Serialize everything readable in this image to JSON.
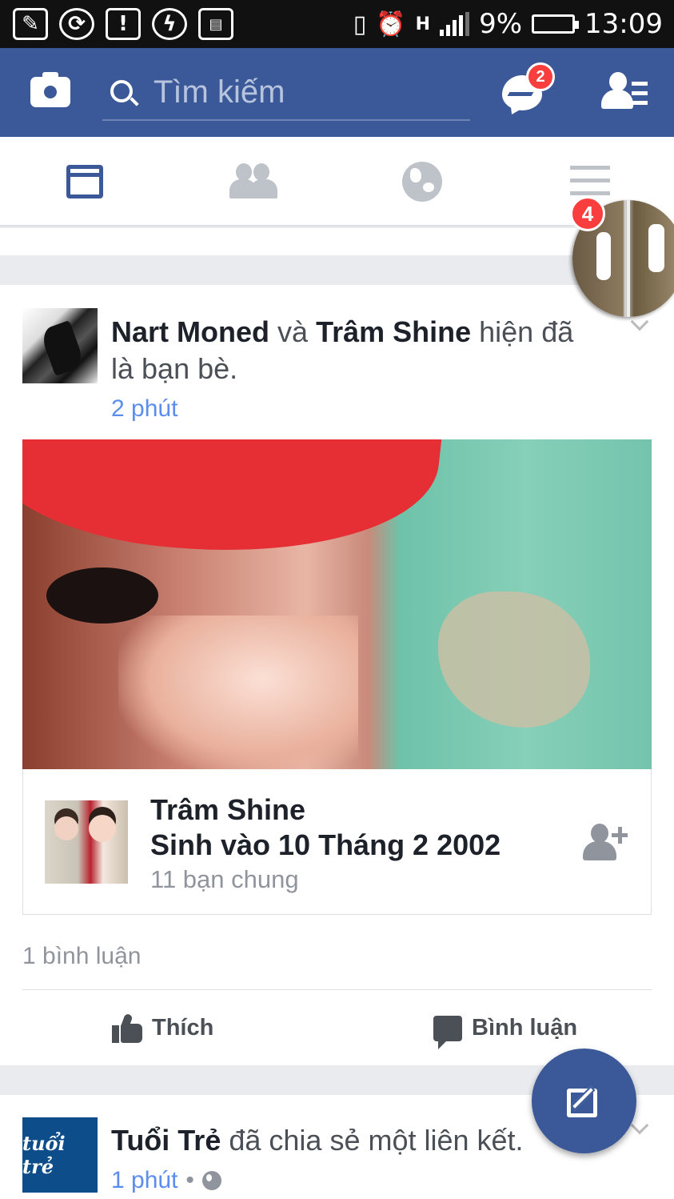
{
  "status_bar": {
    "battery_percent": "9%",
    "time": "13:09",
    "network": "H",
    "alert_icon": "!"
  },
  "top_bar": {
    "search_placeholder": "Tìm kiếm",
    "messenger_badge": "2",
    "bar_color": "#3b5998"
  },
  "nav_tabs": [
    {
      "name": "news-feed",
      "active": true
    },
    {
      "name": "friends",
      "active": false
    },
    {
      "name": "notifications-globe",
      "active": false
    },
    {
      "name": "menu",
      "active": false
    }
  ],
  "chat_head": {
    "badge": "4"
  },
  "story": {
    "actor1": "Nart Moned",
    "connector": "và",
    "actor2": "Trâm Shine",
    "action": "hiện đã là bạn bè.",
    "time": "2 phút",
    "profile_card": {
      "name": "Trâm Shine",
      "birthday": "Sinh vào 10 Tháng 2 2002",
      "mutual_friends": "11 bạn chung"
    },
    "comments_count": "1 bình luận",
    "like_label": "Thích",
    "comment_label": "Bình luận"
  },
  "story2": {
    "page_name": "Tuổi Trẻ",
    "action": "đã chia sẻ một liên kết.",
    "time": "1 phút",
    "separator": "•",
    "logo_text": "tuổi trẻ"
  },
  "colors": {
    "brand_blue": "#3b5998",
    "link_blue": "#5a8dee",
    "badge_red": "#fa3e3e"
  }
}
